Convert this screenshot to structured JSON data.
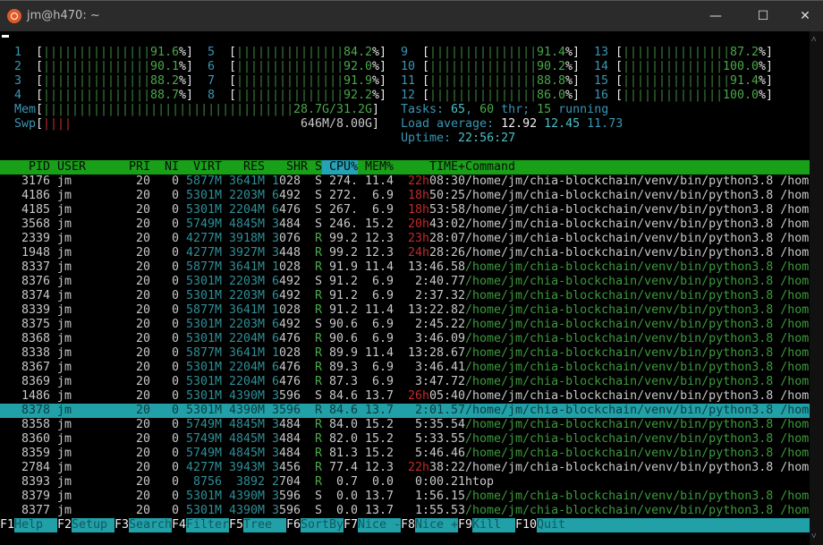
{
  "window": {
    "title": "jm@h470: ~",
    "minimize": "—",
    "maximize": "☐",
    "close": "✕",
    "icon": "ubuntu-icon"
  },
  "cpus": [
    {
      "id": "1",
      "pct": "91.6"
    },
    {
      "id": "2",
      "pct": "90.1"
    },
    {
      "id": "3",
      "pct": "88.2"
    },
    {
      "id": "4",
      "pct": "88.7"
    },
    {
      "id": "5",
      "pct": "84.2"
    },
    {
      "id": "6",
      "pct": "92.0"
    },
    {
      "id": "7",
      "pct": "91.9"
    },
    {
      "id": "8",
      "pct": "92.2"
    },
    {
      "id": "9",
      "pct": "91.4"
    },
    {
      "id": "10",
      "pct": "90.2"
    },
    {
      "id": "11",
      "pct": "88.8"
    },
    {
      "id": "12",
      "pct": "86.0"
    },
    {
      "id": "13",
      "pct": "87.2"
    },
    {
      "id": "14",
      "pct": "100.0"
    },
    {
      "id": "15",
      "pct": "91.4"
    },
    {
      "id": "16",
      "pct": "100.0"
    }
  ],
  "mem": {
    "label": "Mem",
    "value": "28.7G/31.2G",
    "fraction": 0.92
  },
  "swp": {
    "label": "Swp",
    "value": "646M/8.00G",
    "fraction": 0.08
  },
  "tasks": {
    "label": "Tasks: ",
    "count": "65",
    "sep": ", ",
    "thr": "60",
    "thr_label": " thr; ",
    "running": "15",
    "running_label": " running"
  },
  "load": {
    "label": "Load average: ",
    "l1": "12.92",
    "l5": "12.45",
    "l15": "11.73"
  },
  "uptime": {
    "label": "Uptime: ",
    "value": "22:56:27"
  },
  "columns": [
    "PID",
    "USER",
    "PRI",
    "NI",
    "VIRT",
    "RES",
    "SHR",
    "S",
    "CPU%",
    "MEM%",
    "TIME+",
    "Command"
  ],
  "sort_column": "CPU%",
  "processes": [
    {
      "pid": "3176",
      "user": "jm",
      "pri": "20",
      "ni": "0",
      "virt": "5877M",
      "res": "3641M",
      "shr": "1028",
      "s": "S",
      "cpu": "274.",
      "mem": "11.4",
      "time_h": "22h",
      "time": "08:30",
      "cmd": "/home/jm/chia-blockchain/venv/bin/python3.8 /hom",
      "thread": false
    },
    {
      "pid": "4186",
      "user": "jm",
      "pri": "20",
      "ni": "0",
      "virt": "5301M",
      "res": "2203M",
      "shr": "6492",
      "s": "S",
      "cpu": "272.",
      "mem": "6.9",
      "time_h": "18h",
      "time": "50:25",
      "cmd": "/home/jm/chia-blockchain/venv/bin/python3.8 /hom",
      "thread": false
    },
    {
      "pid": "4185",
      "user": "jm",
      "pri": "20",
      "ni": "0",
      "virt": "5301M",
      "res": "2204M",
      "shr": "6476",
      "s": "S",
      "cpu": "267.",
      "mem": "6.9",
      "time_h": "18h",
      "time": "53:58",
      "cmd": "/home/jm/chia-blockchain/venv/bin/python3.8 /hom",
      "thread": false
    },
    {
      "pid": "3568",
      "user": "jm",
      "pri": "20",
      "ni": "0",
      "virt": "5749M",
      "res": "4845M",
      "shr": "3484",
      "s": "S",
      "cpu": "246.",
      "mem": "15.2",
      "time_h": "20h",
      "time": "43:02",
      "cmd": "/home/jm/chia-blockchain/venv/bin/python3.8 /hom",
      "thread": false
    },
    {
      "pid": "2339",
      "user": "jm",
      "pri": "20",
      "ni": "0",
      "virt": "4277M",
      "res": "3918M",
      "shr": "3076",
      "s": "R",
      "cpu": "99.2",
      "mem": "12.3",
      "time_h": "23h",
      "time": "28:07",
      "cmd": "/home/jm/chia-blockchain/venv/bin/python3.8 /hom",
      "thread": false
    },
    {
      "pid": "1948",
      "user": "jm",
      "pri": "20",
      "ni": "0",
      "virt": "4277M",
      "res": "3927M",
      "shr": "3448",
      "s": "R",
      "cpu": "99.2",
      "mem": "12.3",
      "time_h": "24h",
      "time": "28:26",
      "cmd": "/home/jm/chia-blockchain/venv/bin/python3.8 /hom",
      "thread": false
    },
    {
      "pid": "8337",
      "user": "jm",
      "pri": "20",
      "ni": "0",
      "virt": "5877M",
      "res": "3641M",
      "shr": "1028",
      "s": "R",
      "cpu": "91.9",
      "mem": "11.4",
      "time_h": "",
      "time": "13:46.58",
      "cmd": "/home/jm/chia-blockchain/venv/bin/python3.8 /hom",
      "thread": true
    },
    {
      "pid": "8376",
      "user": "jm",
      "pri": "20",
      "ni": "0",
      "virt": "5301M",
      "res": "2203M",
      "shr": "6492",
      "s": "S",
      "cpu": "91.2",
      "mem": "6.9",
      "time_h": "",
      "time": "2:40.77",
      "cmd": "/home/jm/chia-blockchain/venv/bin/python3.8 /hom",
      "thread": true
    },
    {
      "pid": "8374",
      "user": "jm",
      "pri": "20",
      "ni": "0",
      "virt": "5301M",
      "res": "2203M",
      "shr": "6492",
      "s": "R",
      "cpu": "91.2",
      "mem": "6.9",
      "time_h": "",
      "time": "2:37.32",
      "cmd": "/home/jm/chia-blockchain/venv/bin/python3.8 /hom",
      "thread": true
    },
    {
      "pid": "8339",
      "user": "jm",
      "pri": "20",
      "ni": "0",
      "virt": "5877M",
      "res": "3641M",
      "shr": "1028",
      "s": "R",
      "cpu": "91.2",
      "mem": "11.4",
      "time_h": "",
      "time": "13:22.82",
      "cmd": "/home/jm/chia-blockchain/venv/bin/python3.8 /hom",
      "thread": true
    },
    {
      "pid": "8375",
      "user": "jm",
      "pri": "20",
      "ni": "0",
      "virt": "5301M",
      "res": "2203M",
      "shr": "6492",
      "s": "S",
      "cpu": "90.6",
      "mem": "6.9",
      "time_h": "",
      "time": "2:45.22",
      "cmd": "/home/jm/chia-blockchain/venv/bin/python3.8 /hom",
      "thread": true
    },
    {
      "pid": "8368",
      "user": "jm",
      "pri": "20",
      "ni": "0",
      "virt": "5301M",
      "res": "2204M",
      "shr": "6476",
      "s": "R",
      "cpu": "90.6",
      "mem": "6.9",
      "time_h": "",
      "time": "3:46.09",
      "cmd": "/home/jm/chia-blockchain/venv/bin/python3.8 /hom",
      "thread": true
    },
    {
      "pid": "8338",
      "user": "jm",
      "pri": "20",
      "ni": "0",
      "virt": "5877M",
      "res": "3641M",
      "shr": "1028",
      "s": "R",
      "cpu": "89.9",
      "mem": "11.4",
      "time_h": "",
      "time": "13:28.67",
      "cmd": "/home/jm/chia-blockchain/venv/bin/python3.8 /hom",
      "thread": true
    },
    {
      "pid": "8367",
      "user": "jm",
      "pri": "20",
      "ni": "0",
      "virt": "5301M",
      "res": "2204M",
      "shr": "6476",
      "s": "R",
      "cpu": "89.3",
      "mem": "6.9",
      "time_h": "",
      "time": "3:46.41",
      "cmd": "/home/jm/chia-blockchain/venv/bin/python3.8 /hom",
      "thread": true
    },
    {
      "pid": "8369",
      "user": "jm",
      "pri": "20",
      "ni": "0",
      "virt": "5301M",
      "res": "2204M",
      "shr": "6476",
      "s": "R",
      "cpu": "87.3",
      "mem": "6.9",
      "time_h": "",
      "time": "3:47.72",
      "cmd": "/home/jm/chia-blockchain/venv/bin/python3.8 /hom",
      "thread": true
    },
    {
      "pid": "1486",
      "user": "jm",
      "pri": "20",
      "ni": "0",
      "virt": "5301M",
      "res": "4390M",
      "shr": "3596",
      "s": "S",
      "cpu": "84.6",
      "mem": "13.7",
      "time_h": "26h",
      "time": "05:40",
      "cmd": "/home/jm/chia-blockchain/venv/bin/python3.8 /hom",
      "thread": false
    },
    {
      "pid": "8378",
      "user": "jm",
      "pri": "20",
      "ni": "0",
      "virt": "5301M",
      "res": "4390M",
      "shr": "3596",
      "s": "R",
      "cpu": "84.6",
      "mem": "13.7",
      "time_h": "",
      "time": "2:01.57",
      "cmd": "/home/jm/chia-blockchain/venv/bin/python3.8 /hom",
      "thread": true,
      "selected": true
    },
    {
      "pid": "8358",
      "user": "jm",
      "pri": "20",
      "ni": "0",
      "virt": "5749M",
      "res": "4845M",
      "shr": "3484",
      "s": "R",
      "cpu": "84.0",
      "mem": "15.2",
      "time_h": "",
      "time": "5:35.54",
      "cmd": "/home/jm/chia-blockchain/venv/bin/python3.8 /hom",
      "thread": true
    },
    {
      "pid": "8360",
      "user": "jm",
      "pri": "20",
      "ni": "0",
      "virt": "5749M",
      "res": "4845M",
      "shr": "3484",
      "s": "R",
      "cpu": "82.0",
      "mem": "15.2",
      "time_h": "",
      "time": "5:33.55",
      "cmd": "/home/jm/chia-blockchain/venv/bin/python3.8 /hom",
      "thread": true
    },
    {
      "pid": "8359",
      "user": "jm",
      "pri": "20",
      "ni": "0",
      "virt": "5749M",
      "res": "4845M",
      "shr": "3484",
      "s": "R",
      "cpu": "81.3",
      "mem": "15.2",
      "time_h": "",
      "time": "5:46.46",
      "cmd": "/home/jm/chia-blockchain/venv/bin/python3.8 /hom",
      "thread": true
    },
    {
      "pid": "2784",
      "user": "jm",
      "pri": "20",
      "ni": "0",
      "virt": "4277M",
      "res": "3943M",
      "shr": "3456",
      "s": "R",
      "cpu": "77.4",
      "mem": "12.3",
      "time_h": "22h",
      "time": "38:22",
      "cmd": "/home/jm/chia-blockchain/venv/bin/python3.8 /hom",
      "thread": false
    },
    {
      "pid": "8393",
      "user": "jm",
      "pri": "20",
      "ni": "0",
      "virt": "8756",
      "res": "3892",
      "shr": "2704",
      "s": "R",
      "cpu": "0.7",
      "mem": "0.0",
      "time_h": "",
      "time": "0:00.21",
      "cmd": "htop",
      "thread": false
    },
    {
      "pid": "8379",
      "user": "jm",
      "pri": "20",
      "ni": "0",
      "virt": "5301M",
      "res": "4390M",
      "shr": "3596",
      "s": "S",
      "cpu": "0.0",
      "mem": "13.7",
      "time_h": "",
      "time": "1:56.15",
      "cmd": "/home/jm/chia-blockchain/venv/bin/python3.8 /hom",
      "thread": true
    },
    {
      "pid": "8377",
      "user": "jm",
      "pri": "20",
      "ni": "0",
      "virt": "5301M",
      "res": "4390M",
      "shr": "3596",
      "s": "S",
      "cpu": "0.0",
      "mem": "13.7",
      "time_h": "",
      "time": "1:55.53",
      "cmd": "/home/jm/chia-blockchain/venv/bin/python3.8 /hom",
      "thread": true
    }
  ],
  "footer": [
    {
      "key": "F1",
      "label": "Help"
    },
    {
      "key": "F2",
      "label": "Setup"
    },
    {
      "key": "F3",
      "label": "Search"
    },
    {
      "key": "F4",
      "label": "Filter"
    },
    {
      "key": "F5",
      "label": "Tree"
    },
    {
      "key": "F6",
      "label": "SortBy"
    },
    {
      "key": "F7",
      "label": "Nice -"
    },
    {
      "key": "F8",
      "label": "Nice +"
    },
    {
      "key": "F9",
      "label": "Kill"
    },
    {
      "key": "F10",
      "label": "Quit"
    }
  ],
  "colors": {
    "header_bg": "#19a019",
    "selected_bg": "#21a0a8",
    "footer_bg": "#21a0a8",
    "bar_green": "#3d7f3d",
    "swap_red": "#c02a2a",
    "time_hours": "#c02a2a"
  }
}
